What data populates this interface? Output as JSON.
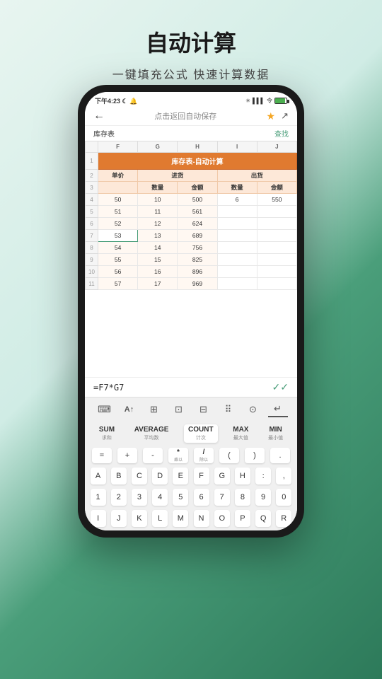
{
  "page": {
    "title": "自动计算",
    "subtitle": "一键填充公式  快速计算数据"
  },
  "status_bar": {
    "time": "下午4:23",
    "icons_right": "* .ill .ill 令"
  },
  "nav": {
    "back_icon": "←",
    "center_text": "点击返回自动保存",
    "star_icon": "★",
    "export_icon": "↗"
  },
  "toolbar": {
    "left": "库存表",
    "right": "查找"
  },
  "spreadsheet": {
    "sheet_title": "库存表-自动计算",
    "col_headers": [
      "F",
      "G",
      "H",
      "I",
      "J"
    ],
    "row_numbers": [
      1,
      2,
      3,
      4,
      5,
      6,
      7,
      8,
      9,
      10,
      11
    ],
    "headers_row2": [
      "单价",
      "",
      "进货",
      "",
      "出货"
    ],
    "headers_row3": [
      "",
      "",
      "数量",
      "金额",
      "数量",
      "金额"
    ],
    "data": [
      [
        50,
        10,
        500,
        6,
        550
      ],
      [
        51,
        11,
        561,
        "",
        ""
      ],
      [
        52,
        12,
        624,
        "",
        ""
      ],
      [
        53,
        13,
        689,
        "",
        ""
      ],
      [
        54,
        14,
        756,
        "",
        ""
      ],
      [
        55,
        15,
        825,
        "",
        ""
      ],
      [
        56,
        16,
        896,
        "",
        ""
      ],
      [
        57,
        17,
        969,
        "",
        ""
      ]
    ]
  },
  "formula_bar": {
    "formula": "=F7*G7",
    "check_icon": "✓✓"
  },
  "kb_toolbar": {
    "icons": [
      "⌨",
      "A↑",
      "⊞",
      "⊡",
      "⊟",
      "⠿",
      "♻",
      "↵"
    ]
  },
  "func_row": {
    "functions": [
      {
        "label": "SUM",
        "sub": "求和"
      },
      {
        "label": "AVERAGE",
        "sub": "平均数"
      },
      {
        "label": "COUNT",
        "sub": "计次"
      },
      {
        "label": "MAX",
        "sub": "最大值"
      },
      {
        "label": "MIN",
        "sub": "最小值"
      }
    ]
  },
  "op_row": {
    "operators": [
      "=",
      "+",
      "-",
      "*",
      "/",
      "(",
      ")",
      "."
    ],
    "op_subs": [
      "",
      "",
      "",
      "乘以",
      "除以",
      "",
      "",
      ""
    ]
  },
  "letter_rows": [
    [
      "A",
      "B",
      "C",
      "D",
      "E",
      "F",
      "G",
      "H",
      ":",
      ","
    ],
    [
      "1",
      "2",
      "3",
      "4",
      "5",
      "6",
      "7",
      "8",
      "9",
      "0"
    ],
    [
      "I",
      "J",
      "K",
      "L",
      "M",
      "N",
      "O",
      "P",
      "Q",
      "R"
    ]
  ],
  "colors": {
    "orange_header": "#e07a30",
    "orange_bg": "#fde8d8",
    "green_accent": "#4a9e7a",
    "selected_border": "#4a9e7a"
  }
}
